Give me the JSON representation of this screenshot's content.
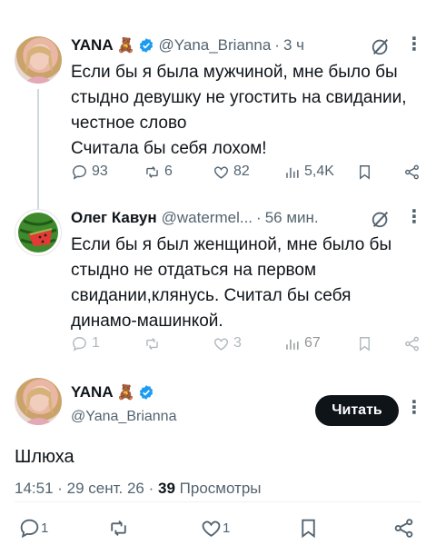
{
  "tweet1": {
    "name": "YANA",
    "emoji": "🧸",
    "handle": "@Yana_Brianna",
    "time": "3 ч",
    "text": [
      "Если бы я была мужчиной, мне было бы",
      "стыдно девушку не угостить на свидании,",
      "честное слово",
      "Считала бы себя лохом!"
    ],
    "replies": "93",
    "reposts": "6",
    "likes": "82",
    "views": "5,4K"
  },
  "tweet2": {
    "name": "Олег Кавун",
    "handle": "@watermel...",
    "time": "56 мин.",
    "text": [
      "Если бы я был женщиной, мне было бы",
      "стыдно не отдаться на первом",
      "свидании,клянусь. Считал бы себя",
      "динамо-машинкой."
    ],
    "replies": "1",
    "reposts": "",
    "likes": "3",
    "views": "67"
  },
  "tweet3": {
    "name": "YANA",
    "emoji": "🧸",
    "handle": "@Yana_Brianna",
    "follow_label": "Читать",
    "text": "Шлюха",
    "timestamp": "14:51 · 29 сент. 26 ·",
    "views_count": "39",
    "views_label": "Просмотры",
    "replies": "1",
    "likes": "1"
  },
  "colors": {
    "verified": "#1d9bf0",
    "text": "#0f1419",
    "secondary": "#536471",
    "button": "#0f1419"
  },
  "icons": [
    "verified-badge-icon",
    "grok-icon",
    "more-icon",
    "reply-icon",
    "repost-icon",
    "like-icon",
    "views-icon",
    "bookmark-icon",
    "share-icon"
  ]
}
